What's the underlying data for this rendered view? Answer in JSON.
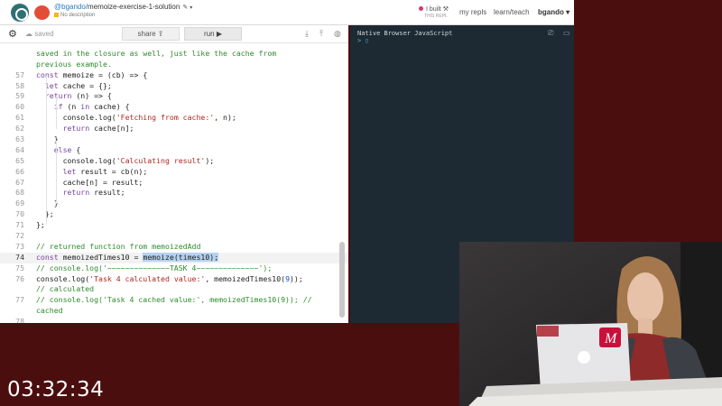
{
  "header": {
    "owner": "@bgando/",
    "repo": "memoize-exercise-1-solution",
    "description": "No description",
    "built_label": "I built",
    "built_sub": "THIS REPL",
    "nav_myrepls": "my repls",
    "nav_learn": "learn/teach",
    "nav_user": "bgando ▾"
  },
  "toolbar": {
    "saved_label": "saved",
    "share_label": "share",
    "run_label": "run ▶"
  },
  "console": {
    "title": "Native Browser JavaScript",
    "prompt": "> ▯"
  },
  "editor": {
    "lines": [
      {
        "n": "",
        "text": "saved in the closure as well, just like the cache from"
      },
      {
        "n": "",
        "text": "previous example."
      },
      {
        "n": "57",
        "text": "const memoize = (cb) => {"
      },
      {
        "n": "58",
        "text": "  let cache = {};"
      },
      {
        "n": "59",
        "text": "  return (n) => {"
      },
      {
        "n": "60",
        "text": "    if (n in cache) {"
      },
      {
        "n": "61",
        "text": "      console.log('Fetching from cache:', n);"
      },
      {
        "n": "62",
        "text": "      return cache[n];"
      },
      {
        "n": "63",
        "text": "    }"
      },
      {
        "n": "64",
        "text": "    else {"
      },
      {
        "n": "65",
        "text": "      console.log('Calculating result');"
      },
      {
        "n": "66",
        "text": "      let result = cb(n);"
      },
      {
        "n": "67",
        "text": "      cache[n] = result;"
      },
      {
        "n": "68",
        "text": "      return result;"
      },
      {
        "n": "69",
        "text": "    }"
      },
      {
        "n": "70",
        "text": "  };"
      },
      {
        "n": "71",
        "text": "};"
      },
      {
        "n": "72",
        "text": ""
      },
      {
        "n": "73",
        "text": "// returned function from memoizedAdd"
      },
      {
        "n": "74",
        "text": "const memoizedTimes10 = memoize(times10);"
      },
      {
        "n": "75",
        "text": "// console.log('~~~~~~~~~~~~~~TASK 4~~~~~~~~~~~~~~');"
      },
      {
        "n": "76",
        "text": "console.log('Task 4 calculated value:', memoizedTimes10(9));"
      },
      {
        "n": "",
        "text": "// calculated"
      },
      {
        "n": "77",
        "text": "// console.log('Task 4 cached value:', memoizedTimes10(9)); //"
      },
      {
        "n": "",
        "text": "cached"
      },
      {
        "n": "78",
        "text": ""
      }
    ]
  },
  "timer": "03:32:34",
  "colors": {
    "background": "#4b0e0f",
    "keyword": "#7a3fa0",
    "string": "#b3261e",
    "comment": "#2e8b2e",
    "console_bg": "#1e2a33",
    "selection": "#b6d2ef"
  }
}
